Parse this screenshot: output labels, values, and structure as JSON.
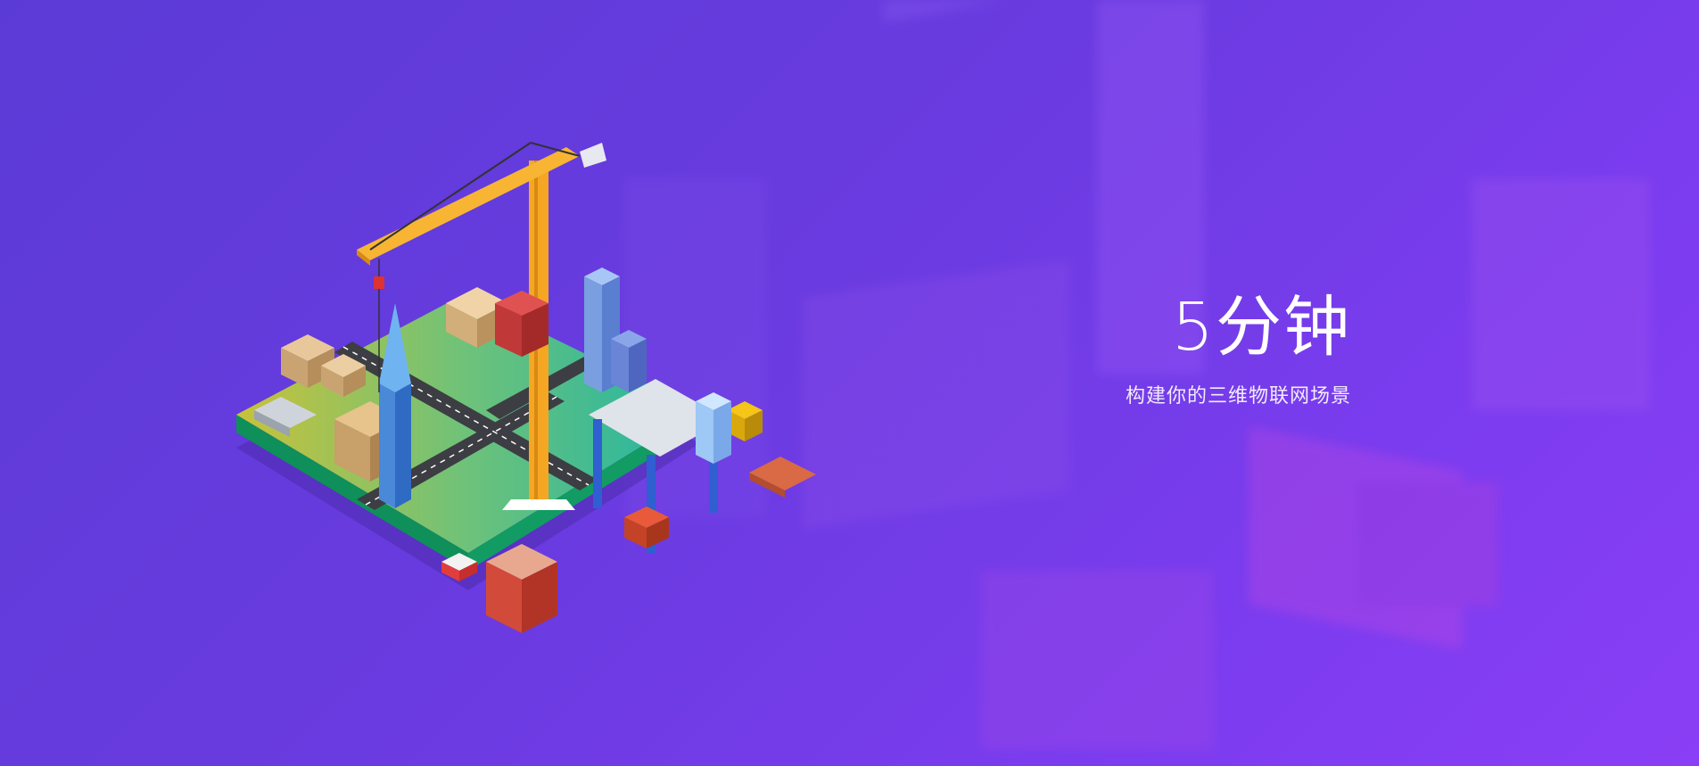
{
  "banner": {
    "headline": "5分钟",
    "subline": "构建你的三维物联网场景"
  },
  "colors": {
    "bg_start": "#5b3bd6",
    "bg_end": "#8a3ef5",
    "text": "#ffffff",
    "crane": "#f5a623",
    "platform_top": "#3dbb8a",
    "platform_side": "#0f8f5a"
  },
  "icons": [
    "crane-icon",
    "skyscraper-icon",
    "box-icon",
    "forklift-icon",
    "truck-icon",
    "gantry-crane-icon",
    "brick-building-icon"
  ]
}
